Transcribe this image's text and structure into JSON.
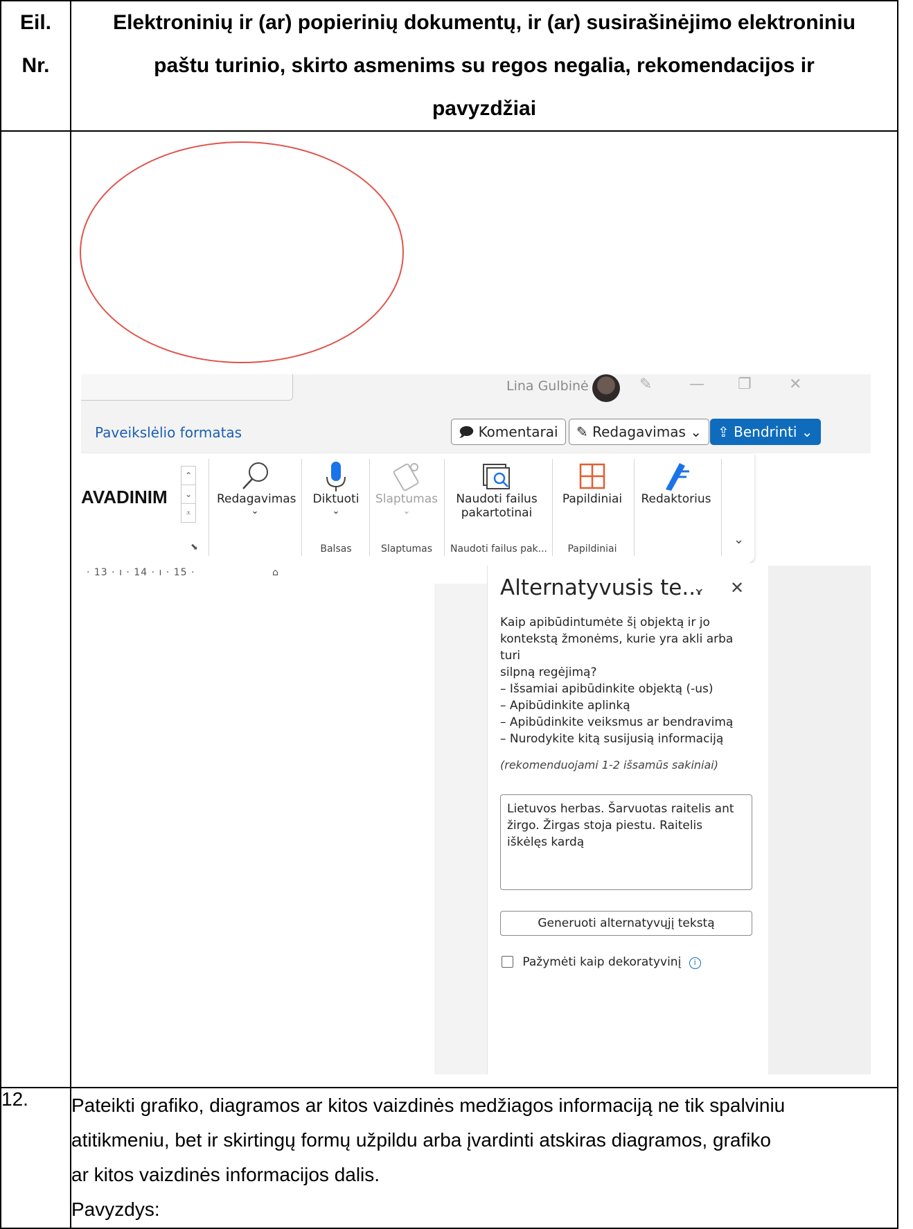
{
  "header": {
    "nr_label": "Eil. Nr.",
    "nr_line1": "Eil.",
    "nr_line2": "Nr.",
    "title_line1": "Elektroninių ir (ar) popierinių dokumentų, ir (ar) susirašinėjimo elektroniniu",
    "title_line2": "paštu turinio, skirto asmenims su regos negalia, rekomendacijos ir",
    "title_line3": "pavyzdžiai"
  },
  "word_ui": {
    "user_name": "Lina Gulbinė",
    "tab_picture_format": "Paveikslėlio formatas",
    "btn_comments": "Komentarai",
    "btn_editing": "Redagavimas",
    "btn_share": "Bendrinti",
    "styles_preview": "AVADINIM",
    "ribbon": {
      "editing": "Redagavimas",
      "dictate": "Diktuoti",
      "sensitivity": "Slaptumas",
      "reuse_files_1": "Naudoti failus",
      "reuse_files_2": "pakartotinai",
      "addins": "Papildiniai",
      "editor": "Redaktorius"
    },
    "groups": {
      "voice": "Balsas",
      "sensitivity": "Slaptumas",
      "reuse": "Naudoti failus pak...",
      "addins": "Papildiniai"
    },
    "ruler": "· 13 ·  ı  · 14 ·  ı  · 15 ·",
    "pane": {
      "title": "Alternatyvusis te...",
      "desc_lines": [
        "Kaip apibūdintumėte šį objektą ir jo",
        "kontekstą žmonėms, kurie yra akli arba turi",
        "silpną regėjimą?",
        "– Išsamiai apibūdinkite objektą (-us)",
        "– Apibūdinkite aplinką",
        "– Apibūdinkite veiksmus ar bendravimą",
        "– Nurodykite kitą susijusią informaciją"
      ],
      "hint": "(rekomenduojami 1-2 išsamūs sakiniai)",
      "alt_text": "Lietuvos herbas. Šarvuotas raitelis ant žirgo. Žirgas stoja piestu. Raitelis iškėlęs kardą",
      "generate_btn": "Generuoti alternatyvųjį tekstą",
      "decorative_label": "Pažymėti kaip dekoratyvinį"
    }
  },
  "row12": {
    "number": "12.",
    "line1": "Pateikti grafiko, diagramos ar kitos vaizdinės medžiagos informaciją ne tik spalviniu",
    "line2": "atitikmeniu, bet ir skirtingų formų užpildu arba įvardinti atskiras diagramos, grafiko",
    "line3": "ar kitos vaizdinės informacijos dalis.",
    "line4": "Pavyzdys:"
  },
  "colors": {
    "ellipse": "#e0534a",
    "accent_blue": "#0f6cbd",
    "link_blue": "#1a5fb4"
  }
}
